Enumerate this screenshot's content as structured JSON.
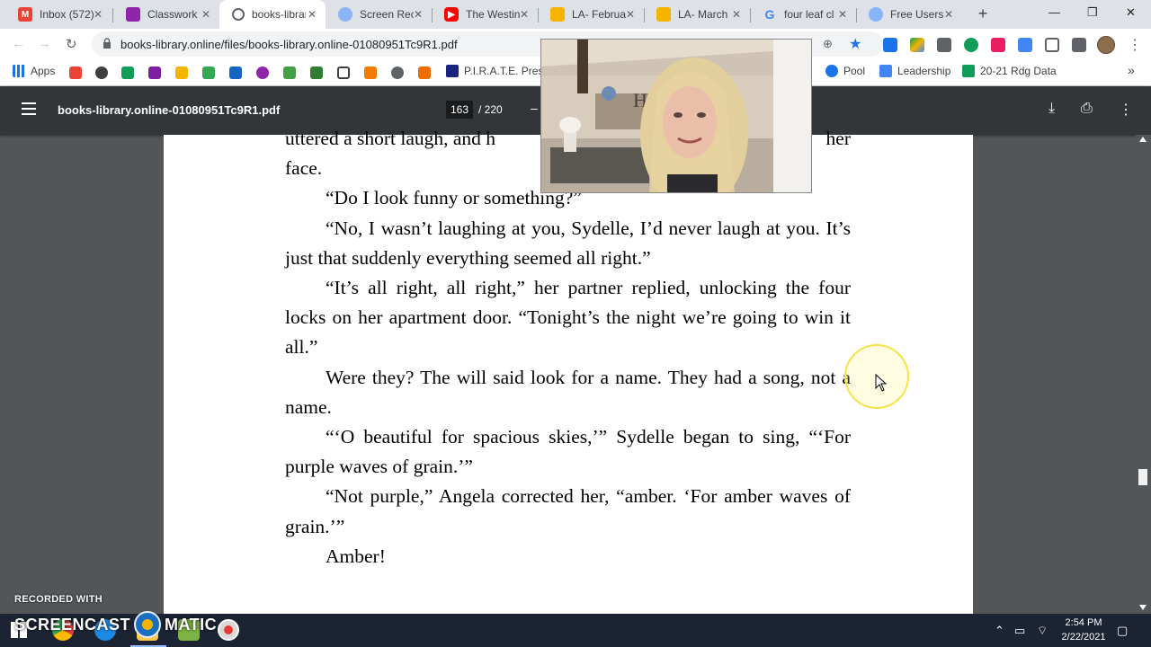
{
  "browser": {
    "tabs": [
      {
        "title": "Inbox (572)",
        "favicon": "gmail-icon",
        "color": "#ea4335"
      },
      {
        "title": "Classwork",
        "favicon": "classroom-icon",
        "color": "#8e24aa"
      },
      {
        "title": "books-library",
        "favicon": "globe-icon",
        "color": "#5f6368"
      },
      {
        "title": "Screen Rec",
        "favicon": "screencast-icon",
        "color": "#4285f4"
      },
      {
        "title": "The Westin",
        "favicon": "youtube-icon",
        "color": "#ff0000"
      },
      {
        "title": "LA- Februa",
        "favicon": "slides-icon",
        "color": "#f4b400"
      },
      {
        "title": "LA- March",
        "favicon": "slides-icon",
        "color": "#f4b400"
      },
      {
        "title": "four leaf cl",
        "favicon": "google-icon",
        "color": "#4285f4"
      },
      {
        "title": "Free Users",
        "favicon": "screencast-icon",
        "color": "#4285f4"
      }
    ],
    "url": "books-library.online/files/books-library.online-01080951Tc9R1.pdf",
    "bookmarks": [
      {
        "label": "Apps",
        "icon": "apps-grid-icon"
      },
      {
        "label": "P.I.R.A.T.E. Press",
        "icon": "bookmark-icon"
      },
      {
        "label": "Pool",
        "icon": "pool-icon"
      },
      {
        "label": "Leadership",
        "icon": "docs-icon"
      },
      {
        "label": "20-21 Rdg Data",
        "icon": "sheets-icon"
      }
    ],
    "more_bookmarks": "»"
  },
  "pdf": {
    "title": "books-library.online-01080951Tc9R1.pdf",
    "current_page": "163",
    "total_pages": "/ 220"
  },
  "page_text": {
    "line_top": "uttered a short laugh, and h",
    "line_top_end": "her",
    "p1_end": "face.",
    "p2": "“Do I look funny or something?”",
    "p3": "“No, I wasn’t laughing at you, Sydelle, I’d never laugh at you. It’s just that suddenly everything seemed all right.”",
    "p4": "“It’s all right, all right,” her partner replied, unlocking the four locks on her apartment door. “Tonight’s the night we’re going to win it all.”",
    "p5": "Were they? The will said look for a name. They had a song, not a name.",
    "p6": "“‘O beautiful for spacious skies,’” Sydelle began to sing, “‘For purple waves of grain.’”",
    "p7": "“Not purple,” Angela corrected her, “amber. ‘For amber waves of grain.’”",
    "p8": "Amber!"
  },
  "watermark": {
    "recorded_with": "RECORDED WITH",
    "brand_left": "SCREENCAST",
    "brand_right": "MATIC"
  },
  "taskbar": {
    "time": "2:54 PM",
    "date": "2/22/2021"
  }
}
